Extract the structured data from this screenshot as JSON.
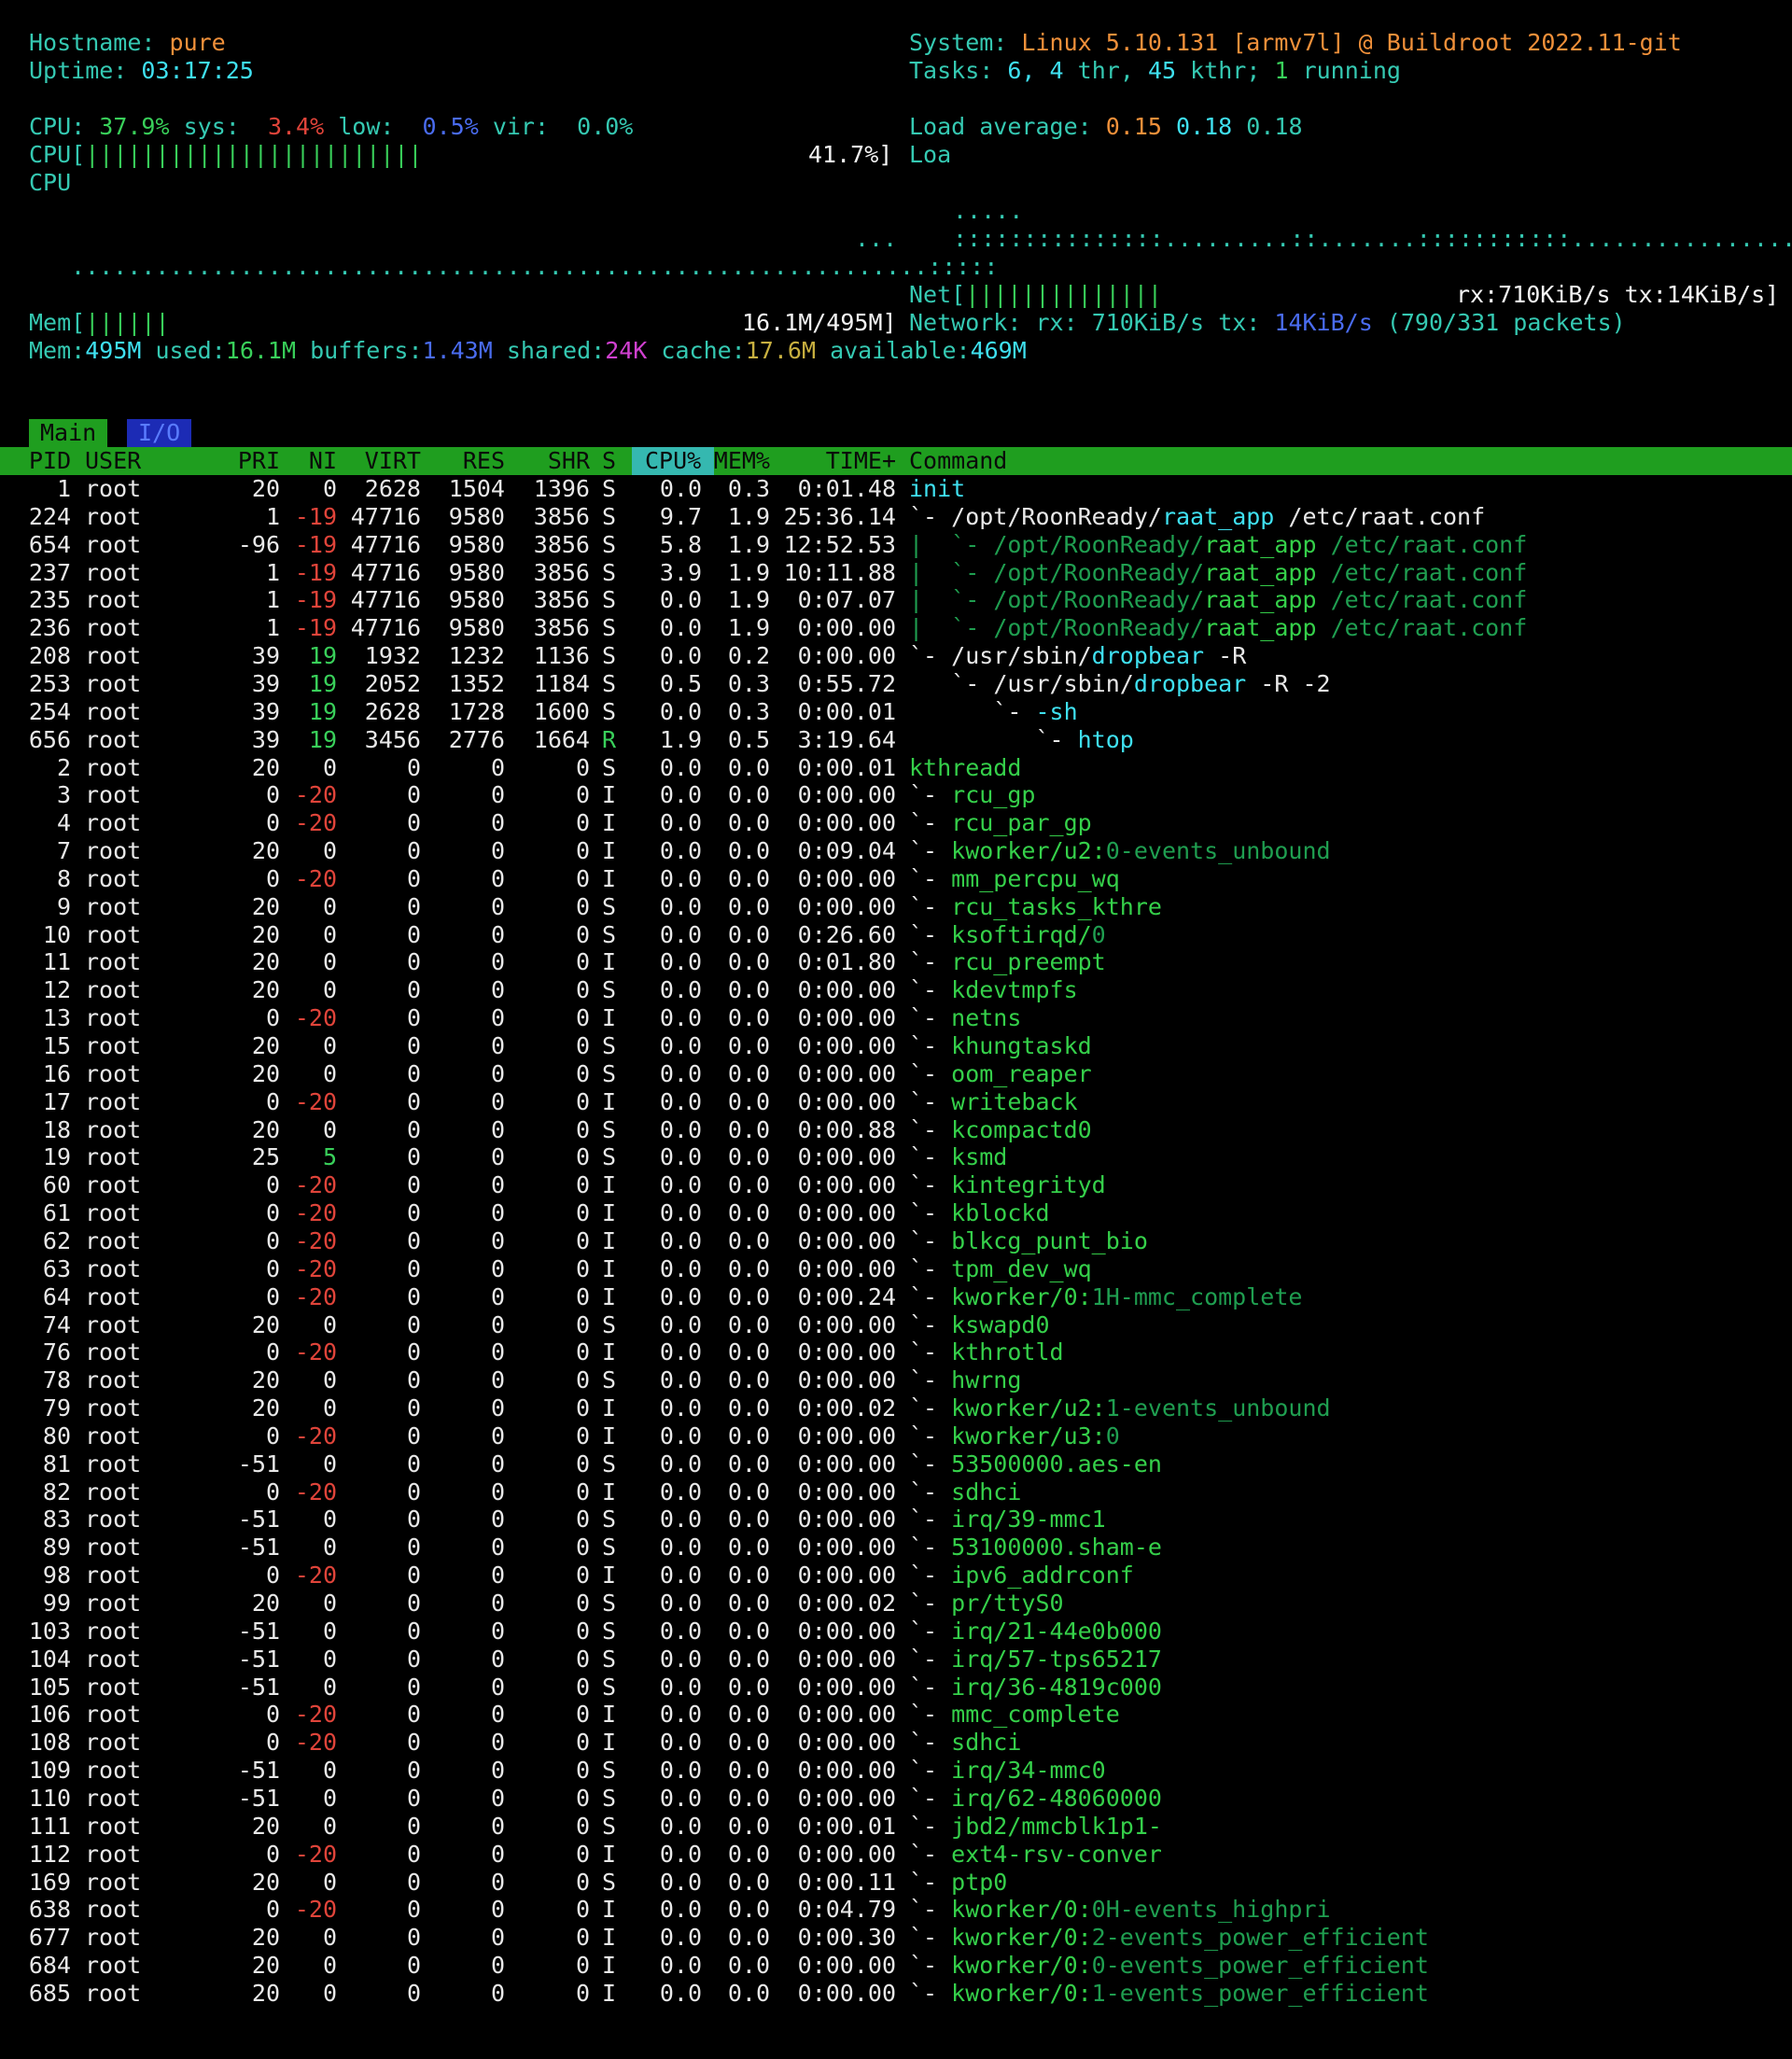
{
  "header": {
    "hostname_label": "Hostname:",
    "hostname": "pure",
    "uptime_label": "Uptime:",
    "uptime": "03:17:25",
    "system_label": "System:",
    "system": "Linux 5.10.131 [armv7l] @ Buildroot 2022.11-git",
    "tasks_label": "Tasks:",
    "tasks_count": "6,",
    "tasks_thr": "4",
    "tasks_thr_label": "thr,",
    "tasks_kthr": "45",
    "tasks_kthr_label": "kthr;",
    "tasks_running": "1",
    "tasks_running_label": "running"
  },
  "cpu": {
    "label": "CPU:",
    "user": "37.9%",
    "sys_label": "sys:",
    "sys": "3.4%",
    "low_label": "low:",
    "low": "0.5%",
    "vir_label": "vir:",
    "vir": "0.0%",
    "bar_label": "CPU[",
    "bar": "||||||||||||||||||||||||",
    "bar_value": "41.7%]",
    "graph_label": "CPU",
    "load_label": "Load average:",
    "load1": "0.15",
    "load5": "0.18",
    "load15": "0.18",
    "loa_label": "Loa"
  },
  "graphs": {
    "cpu_dots_top": "...",
    "cpu_dots": ".............................................................:::::",
    "load_dots_top": ".....",
    "load_dots": ":::::::::::::::.........::.......:::::::::::................"
  },
  "net": {
    "bar_label": "Net[",
    "bar": "||||||||||||||",
    "bar_value": "rx:710KiB/s tx:14KiB/s]",
    "network_label": "Network:",
    "rx_label": "rx:",
    "rx": "710KiB/s",
    "tx_label": "tx:",
    "tx": "14KiB/s",
    "packets": "(790/331 packets)"
  },
  "mem": {
    "bar_label": "Mem[",
    "bar": "||||||",
    "bar_value": "16.1M/495M]",
    "total_label": "Mem:",
    "total": "495M",
    "used_label": "used:",
    "used": "16.1M",
    "buffers_label": "buffers:",
    "buffers": "1.43M",
    "shared_label": "shared:",
    "shared": "24K",
    "cache_label": "cache:",
    "cache": "17.6M",
    "available_label": "available:",
    "available": "469M"
  },
  "tabs": {
    "main": "Main",
    "io": "I/O"
  },
  "columns": [
    "PID",
    "USER",
    "PRI",
    "NI",
    "VIRT",
    "RES",
    "SHR",
    "S",
    "CPU%",
    "MEM%",
    "TIME+",
    "Command"
  ],
  "colors": {
    "header_bg": "#1f9e1f",
    "io_tab_bg": "#1c2bb5",
    "accent_cyan": "#3fe0f0",
    "accent_orange": "#f0903a"
  },
  "processes": [
    {
      "pid": "1",
      "user": "root",
      "pri": "20",
      "ni": "0",
      "virt": "2628",
      "res": "1504",
      "shr": "1396",
      "s": "S",
      "cpu": "0.0",
      "mem": "0.3",
      "time": "0:01.48",
      "tree": "",
      "cmd": "init",
      "args": "",
      "kind": "cmdhi"
    },
    {
      "pid": "224",
      "user": "root",
      "pri": "1",
      "ni": "-19",
      "virt": "47716",
      "res": "9580",
      "shr": "3856",
      "s": "S",
      "cpu": "9.7",
      "mem": "1.9",
      "time": "25:36.14",
      "tree": "`- ",
      "cmd": "/opt/RoonReady/raat_app",
      "args": " /etc/raat.conf",
      "kind": "proc"
    },
    {
      "pid": "654",
      "user": "root",
      "pri": "-96",
      "ni": "-19",
      "virt": "47716",
      "res": "9580",
      "shr": "3856",
      "s": "S",
      "cpu": "5.8",
      "mem": "1.9",
      "time": "12:52.53",
      "tree": "|  `- ",
      "cmd": "/opt/RoonReady/raat_app",
      "args": " /etc/raat.conf",
      "kind": "thread"
    },
    {
      "pid": "237",
      "user": "root",
      "pri": "1",
      "ni": "-19",
      "virt": "47716",
      "res": "9580",
      "shr": "3856",
      "s": "S",
      "cpu": "3.9",
      "mem": "1.9",
      "time": "10:11.88",
      "tree": "|  `- ",
      "cmd": "/opt/RoonReady/raat_app",
      "args": " /etc/raat.conf",
      "kind": "thread"
    },
    {
      "pid": "235",
      "user": "root",
      "pri": "1",
      "ni": "-19",
      "virt": "47716",
      "res": "9580",
      "shr": "3856",
      "s": "S",
      "cpu": "0.0",
      "mem": "1.9",
      "time": "0:07.07",
      "tree": "|  `- ",
      "cmd": "/opt/RoonReady/raat_app",
      "args": " /etc/raat.conf",
      "kind": "thread"
    },
    {
      "pid": "236",
      "user": "root",
      "pri": "1",
      "ni": "-19",
      "virt": "47716",
      "res": "9580",
      "shr": "3856",
      "s": "S",
      "cpu": "0.0",
      "mem": "1.9",
      "time": "0:00.00",
      "tree": "|  `- ",
      "cmd": "/opt/RoonReady/raat_app",
      "args": " /etc/raat.conf",
      "kind": "thread"
    },
    {
      "pid": "208",
      "user": "root",
      "pri": "39",
      "ni": "19",
      "virt": "1932",
      "res": "1232",
      "shr": "1136",
      "s": "S",
      "cpu": "0.0",
      "mem": "0.2",
      "time": "0:00.00",
      "tree": "`- ",
      "cmd": "/usr/sbin/dropbear",
      "args": " -R",
      "kind": "proc"
    },
    {
      "pid": "253",
      "user": "root",
      "pri": "39",
      "ni": "19",
      "virt": "2052",
      "res": "1352",
      "shr": "1184",
      "s": "S",
      "cpu": "0.5",
      "mem": "0.3",
      "time": "0:55.72",
      "tree": "   `- ",
      "cmd": "/usr/sbin/dropbear",
      "args": " -R -2",
      "kind": "proc"
    },
    {
      "pid": "254",
      "user": "root",
      "pri": "39",
      "ni": "19",
      "virt": "2628",
      "res": "1728",
      "shr": "1600",
      "s": "S",
      "cpu": "0.0",
      "mem": "0.3",
      "time": "0:00.01",
      "tree": "      `- ",
      "cmd": "-sh",
      "args": "",
      "kind": "cmdhi"
    },
    {
      "pid": "656",
      "user": "root",
      "pri": "39",
      "ni": "19",
      "virt": "3456",
      "res": "2776",
      "shr": "1664",
      "s": "R",
      "cpu": "1.9",
      "mem": "0.5",
      "time": "3:19.64",
      "tree": "         `- ",
      "cmd": "htop",
      "args": "",
      "kind": "cmdhi"
    },
    {
      "pid": "2",
      "user": "root",
      "pri": "20",
      "ni": "0",
      "virt": "0",
      "res": "0",
      "shr": "0",
      "s": "S",
      "cpu": "0.0",
      "mem": "0.0",
      "time": "0:00.01",
      "tree": "",
      "cmd": "kthreadd",
      "args": "",
      "kind": "kthread"
    },
    {
      "pid": "3",
      "user": "root",
      "pri": "0",
      "ni": "-20",
      "virt": "0",
      "res": "0",
      "shr": "0",
      "s": "I",
      "cpu": "0.0",
      "mem": "0.0",
      "time": "0:00.00",
      "tree": "`- ",
      "cmd": "rcu_gp",
      "args": "",
      "kind": "kthread"
    },
    {
      "pid": "4",
      "user": "root",
      "pri": "0",
      "ni": "-20",
      "virt": "0",
      "res": "0",
      "shr": "0",
      "s": "I",
      "cpu": "0.0",
      "mem": "0.0",
      "time": "0:00.00",
      "tree": "`- ",
      "cmd": "rcu_par_gp",
      "args": "",
      "kind": "kthread"
    },
    {
      "pid": "7",
      "user": "root",
      "pri": "20",
      "ni": "0",
      "virt": "0",
      "res": "0",
      "shr": "0",
      "s": "I",
      "cpu": "0.0",
      "mem": "0.0",
      "time": "0:09.04",
      "tree": "`- ",
      "cmd": "kworker/u2:",
      "args": "0-events_unbound",
      "kind": "kthread"
    },
    {
      "pid": "8",
      "user": "root",
      "pri": "0",
      "ni": "-20",
      "virt": "0",
      "res": "0",
      "shr": "0",
      "s": "I",
      "cpu": "0.0",
      "mem": "0.0",
      "time": "0:00.00",
      "tree": "`- ",
      "cmd": "mm_percpu_wq",
      "args": "",
      "kind": "kthread"
    },
    {
      "pid": "9",
      "user": "root",
      "pri": "20",
      "ni": "0",
      "virt": "0",
      "res": "0",
      "shr": "0",
      "s": "S",
      "cpu": "0.0",
      "mem": "0.0",
      "time": "0:00.00",
      "tree": "`- ",
      "cmd": "rcu_tasks_kthre",
      "args": "",
      "kind": "kthread"
    },
    {
      "pid": "10",
      "user": "root",
      "pri": "20",
      "ni": "0",
      "virt": "0",
      "res": "0",
      "shr": "0",
      "s": "S",
      "cpu": "0.0",
      "mem": "0.0",
      "time": "0:26.60",
      "tree": "`- ",
      "cmd": "ksoftirqd/",
      "args": "0",
      "kind": "kthread"
    },
    {
      "pid": "11",
      "user": "root",
      "pri": "20",
      "ni": "0",
      "virt": "0",
      "res": "0",
      "shr": "0",
      "s": "I",
      "cpu": "0.0",
      "mem": "0.0",
      "time": "0:01.80",
      "tree": "`- ",
      "cmd": "rcu_preempt",
      "args": "",
      "kind": "kthread"
    },
    {
      "pid": "12",
      "user": "root",
      "pri": "20",
      "ni": "0",
      "virt": "0",
      "res": "0",
      "shr": "0",
      "s": "S",
      "cpu": "0.0",
      "mem": "0.0",
      "time": "0:00.00",
      "tree": "`- ",
      "cmd": "kdevtmpfs",
      "args": "",
      "kind": "kthread"
    },
    {
      "pid": "13",
      "user": "root",
      "pri": "0",
      "ni": "-20",
      "virt": "0",
      "res": "0",
      "shr": "0",
      "s": "I",
      "cpu": "0.0",
      "mem": "0.0",
      "time": "0:00.00",
      "tree": "`- ",
      "cmd": "netns",
      "args": "",
      "kind": "kthread"
    },
    {
      "pid": "15",
      "user": "root",
      "pri": "20",
      "ni": "0",
      "virt": "0",
      "res": "0",
      "shr": "0",
      "s": "S",
      "cpu": "0.0",
      "mem": "0.0",
      "time": "0:00.00",
      "tree": "`- ",
      "cmd": "khungtaskd",
      "args": "",
      "kind": "kthread"
    },
    {
      "pid": "16",
      "user": "root",
      "pri": "20",
      "ni": "0",
      "virt": "0",
      "res": "0",
      "shr": "0",
      "s": "S",
      "cpu": "0.0",
      "mem": "0.0",
      "time": "0:00.00",
      "tree": "`- ",
      "cmd": "oom_reaper",
      "args": "",
      "kind": "kthread"
    },
    {
      "pid": "17",
      "user": "root",
      "pri": "0",
      "ni": "-20",
      "virt": "0",
      "res": "0",
      "shr": "0",
      "s": "I",
      "cpu": "0.0",
      "mem": "0.0",
      "time": "0:00.00",
      "tree": "`- ",
      "cmd": "writeback",
      "args": "",
      "kind": "kthread"
    },
    {
      "pid": "18",
      "user": "root",
      "pri": "20",
      "ni": "0",
      "virt": "0",
      "res": "0",
      "shr": "0",
      "s": "S",
      "cpu": "0.0",
      "mem": "0.0",
      "time": "0:00.88",
      "tree": "`- ",
      "cmd": "kcompactd0",
      "args": "",
      "kind": "kthread"
    },
    {
      "pid": "19",
      "user": "root",
      "pri": "25",
      "ni": "5",
      "virt": "0",
      "res": "0",
      "shr": "0",
      "s": "S",
      "cpu": "0.0",
      "mem": "0.0",
      "time": "0:00.00",
      "tree": "`- ",
      "cmd": "ksmd",
      "args": "",
      "kind": "kthread"
    },
    {
      "pid": "60",
      "user": "root",
      "pri": "0",
      "ni": "-20",
      "virt": "0",
      "res": "0",
      "shr": "0",
      "s": "I",
      "cpu": "0.0",
      "mem": "0.0",
      "time": "0:00.00",
      "tree": "`- ",
      "cmd": "kintegrityd",
      "args": "",
      "kind": "kthread"
    },
    {
      "pid": "61",
      "user": "root",
      "pri": "0",
      "ni": "-20",
      "virt": "0",
      "res": "0",
      "shr": "0",
      "s": "I",
      "cpu": "0.0",
      "mem": "0.0",
      "time": "0:00.00",
      "tree": "`- ",
      "cmd": "kblockd",
      "args": "",
      "kind": "kthread"
    },
    {
      "pid": "62",
      "user": "root",
      "pri": "0",
      "ni": "-20",
      "virt": "0",
      "res": "0",
      "shr": "0",
      "s": "I",
      "cpu": "0.0",
      "mem": "0.0",
      "time": "0:00.00",
      "tree": "`- ",
      "cmd": "blkcg_punt_bio",
      "args": "",
      "kind": "kthread"
    },
    {
      "pid": "63",
      "user": "root",
      "pri": "0",
      "ni": "-20",
      "virt": "0",
      "res": "0",
      "shr": "0",
      "s": "I",
      "cpu": "0.0",
      "mem": "0.0",
      "time": "0:00.00",
      "tree": "`- ",
      "cmd": "tpm_dev_wq",
      "args": "",
      "kind": "kthread"
    },
    {
      "pid": "64",
      "user": "root",
      "pri": "0",
      "ni": "-20",
      "virt": "0",
      "res": "0",
      "shr": "0",
      "s": "I",
      "cpu": "0.0",
      "mem": "0.0",
      "time": "0:00.24",
      "tree": "`- ",
      "cmd": "kworker/0:",
      "args": "1H-mmc_complete",
      "kind": "kthread"
    },
    {
      "pid": "74",
      "user": "root",
      "pri": "20",
      "ni": "0",
      "virt": "0",
      "res": "0",
      "shr": "0",
      "s": "S",
      "cpu": "0.0",
      "mem": "0.0",
      "time": "0:00.00",
      "tree": "`- ",
      "cmd": "kswapd0",
      "args": "",
      "kind": "kthread"
    },
    {
      "pid": "76",
      "user": "root",
      "pri": "0",
      "ni": "-20",
      "virt": "0",
      "res": "0",
      "shr": "0",
      "s": "I",
      "cpu": "0.0",
      "mem": "0.0",
      "time": "0:00.00",
      "tree": "`- ",
      "cmd": "kthrotld",
      "args": "",
      "kind": "kthread"
    },
    {
      "pid": "78",
      "user": "root",
      "pri": "20",
      "ni": "0",
      "virt": "0",
      "res": "0",
      "shr": "0",
      "s": "S",
      "cpu": "0.0",
      "mem": "0.0",
      "time": "0:00.00",
      "tree": "`- ",
      "cmd": "hwrng",
      "args": "",
      "kind": "kthread"
    },
    {
      "pid": "79",
      "user": "root",
      "pri": "20",
      "ni": "0",
      "virt": "0",
      "res": "0",
      "shr": "0",
      "s": "I",
      "cpu": "0.0",
      "mem": "0.0",
      "time": "0:00.02",
      "tree": "`- ",
      "cmd": "kworker/u2:",
      "args": "1-events_unbound",
      "kind": "kthread"
    },
    {
      "pid": "80",
      "user": "root",
      "pri": "0",
      "ni": "-20",
      "virt": "0",
      "res": "0",
      "shr": "0",
      "s": "I",
      "cpu": "0.0",
      "mem": "0.0",
      "time": "0:00.00",
      "tree": "`- ",
      "cmd": "kworker/u3:",
      "args": "0",
      "kind": "kthread"
    },
    {
      "pid": "81",
      "user": "root",
      "pri": "-51",
      "ni": "0",
      "virt": "0",
      "res": "0",
      "shr": "0",
      "s": "S",
      "cpu": "0.0",
      "mem": "0.0",
      "time": "0:00.00",
      "tree": "`- ",
      "cmd": "53500000.aes-en",
      "args": "",
      "kind": "kthread"
    },
    {
      "pid": "82",
      "user": "root",
      "pri": "0",
      "ni": "-20",
      "virt": "0",
      "res": "0",
      "shr": "0",
      "s": "I",
      "cpu": "0.0",
      "mem": "0.0",
      "time": "0:00.00",
      "tree": "`- ",
      "cmd": "sdhci",
      "args": "",
      "kind": "kthread"
    },
    {
      "pid": "83",
      "user": "root",
      "pri": "-51",
      "ni": "0",
      "virt": "0",
      "res": "0",
      "shr": "0",
      "s": "S",
      "cpu": "0.0",
      "mem": "0.0",
      "time": "0:00.00",
      "tree": "`- ",
      "cmd": "irq/39-mmc1",
      "args": "",
      "kind": "irq"
    },
    {
      "pid": "89",
      "user": "root",
      "pri": "-51",
      "ni": "0",
      "virt": "0",
      "res": "0",
      "shr": "0",
      "s": "S",
      "cpu": "0.0",
      "mem": "0.0",
      "time": "0:00.00",
      "tree": "`- ",
      "cmd": "53100000.sham-e",
      "args": "",
      "kind": "kthread"
    },
    {
      "pid": "98",
      "user": "root",
      "pri": "0",
      "ni": "-20",
      "virt": "0",
      "res": "0",
      "shr": "0",
      "s": "I",
      "cpu": "0.0",
      "mem": "0.0",
      "time": "0:00.00",
      "tree": "`- ",
      "cmd": "ipv6_addrconf",
      "args": "",
      "kind": "kthread"
    },
    {
      "pid": "99",
      "user": "root",
      "pri": "20",
      "ni": "0",
      "virt": "0",
      "res": "0",
      "shr": "0",
      "s": "S",
      "cpu": "0.0",
      "mem": "0.0",
      "time": "0:00.02",
      "tree": "`- ",
      "cmd": "pr/ttyS0",
      "args": "",
      "kind": "irq"
    },
    {
      "pid": "103",
      "user": "root",
      "pri": "-51",
      "ni": "0",
      "virt": "0",
      "res": "0",
      "shr": "0",
      "s": "S",
      "cpu": "0.0",
      "mem": "0.0",
      "time": "0:00.00",
      "tree": "`- ",
      "cmd": "irq/21-44e0b000",
      "args": "",
      "kind": "irq"
    },
    {
      "pid": "104",
      "user": "root",
      "pri": "-51",
      "ni": "0",
      "virt": "0",
      "res": "0",
      "shr": "0",
      "s": "S",
      "cpu": "0.0",
      "mem": "0.0",
      "time": "0:00.00",
      "tree": "`- ",
      "cmd": "irq/57-tps65217",
      "args": "",
      "kind": "irq"
    },
    {
      "pid": "105",
      "user": "root",
      "pri": "-51",
      "ni": "0",
      "virt": "0",
      "res": "0",
      "shr": "0",
      "s": "S",
      "cpu": "0.0",
      "mem": "0.0",
      "time": "0:00.00",
      "tree": "`- ",
      "cmd": "irq/36-4819c000",
      "args": "",
      "kind": "irq"
    },
    {
      "pid": "106",
      "user": "root",
      "pri": "0",
      "ni": "-20",
      "virt": "0",
      "res": "0",
      "shr": "0",
      "s": "I",
      "cpu": "0.0",
      "mem": "0.0",
      "time": "0:00.00",
      "tree": "`- ",
      "cmd": "mmc_complete",
      "args": "",
      "kind": "kthread"
    },
    {
      "pid": "108",
      "user": "root",
      "pri": "0",
      "ni": "-20",
      "virt": "0",
      "res": "0",
      "shr": "0",
      "s": "I",
      "cpu": "0.0",
      "mem": "0.0",
      "time": "0:00.00",
      "tree": "`- ",
      "cmd": "sdhci",
      "args": "",
      "kind": "kthread"
    },
    {
      "pid": "109",
      "user": "root",
      "pri": "-51",
      "ni": "0",
      "virt": "0",
      "res": "0",
      "shr": "0",
      "s": "S",
      "cpu": "0.0",
      "mem": "0.0",
      "time": "0:00.00",
      "tree": "`- ",
      "cmd": "irq/34-mmc0",
      "args": "",
      "kind": "irq"
    },
    {
      "pid": "110",
      "user": "root",
      "pri": "-51",
      "ni": "0",
      "virt": "0",
      "res": "0",
      "shr": "0",
      "s": "S",
      "cpu": "0.0",
      "mem": "0.0",
      "time": "0:00.00",
      "tree": "`- ",
      "cmd": "irq/62-48060000",
      "args": "",
      "kind": "irq"
    },
    {
      "pid": "111",
      "user": "root",
      "pri": "20",
      "ni": "0",
      "virt": "0",
      "res": "0",
      "shr": "0",
      "s": "S",
      "cpu": "0.0",
      "mem": "0.0",
      "time": "0:00.01",
      "tree": "`- ",
      "cmd": "jbd2/mmcblk1p1-",
      "args": "",
      "kind": "irq"
    },
    {
      "pid": "112",
      "user": "root",
      "pri": "0",
      "ni": "-20",
      "virt": "0",
      "res": "0",
      "shr": "0",
      "s": "I",
      "cpu": "0.0",
      "mem": "0.0",
      "time": "0:00.00",
      "tree": "`- ",
      "cmd": "ext4-rsv-conver",
      "args": "",
      "kind": "kthread"
    },
    {
      "pid": "169",
      "user": "root",
      "pri": "20",
      "ni": "0",
      "virt": "0",
      "res": "0",
      "shr": "0",
      "s": "S",
      "cpu": "0.0",
      "mem": "0.0",
      "time": "0:00.11",
      "tree": "`- ",
      "cmd": "ptp0",
      "args": "",
      "kind": "kthread"
    },
    {
      "pid": "638",
      "user": "root",
      "pri": "0",
      "ni": "-20",
      "virt": "0",
      "res": "0",
      "shr": "0",
      "s": "I",
      "cpu": "0.0",
      "mem": "0.0",
      "time": "0:04.79",
      "tree": "`- ",
      "cmd": "kworker/0:",
      "args": "0H-events_highpri",
      "kind": "kthread"
    },
    {
      "pid": "677",
      "user": "root",
      "pri": "20",
      "ni": "0",
      "virt": "0",
      "res": "0",
      "shr": "0",
      "s": "I",
      "cpu": "0.0",
      "mem": "0.0",
      "time": "0:00.30",
      "tree": "`- ",
      "cmd": "kworker/0:",
      "args": "2-events_power_efficient",
      "kind": "kthread"
    },
    {
      "pid": "684",
      "user": "root",
      "pri": "20",
      "ni": "0",
      "virt": "0",
      "res": "0",
      "shr": "0",
      "s": "I",
      "cpu": "0.0",
      "mem": "0.0",
      "time": "0:00.00",
      "tree": "`- ",
      "cmd": "kworker/0:",
      "args": "0-events_power_efficient",
      "kind": "kthread"
    },
    {
      "pid": "685",
      "user": "root",
      "pri": "20",
      "ni": "0",
      "virt": "0",
      "res": "0",
      "shr": "0",
      "s": "I",
      "cpu": "0.0",
      "mem": "0.0",
      "time": "0:00.00",
      "tree": "`- ",
      "cmd": "kworker/0:",
      "args": "1-events_power_efficient",
      "kind": "kthread"
    }
  ]
}
